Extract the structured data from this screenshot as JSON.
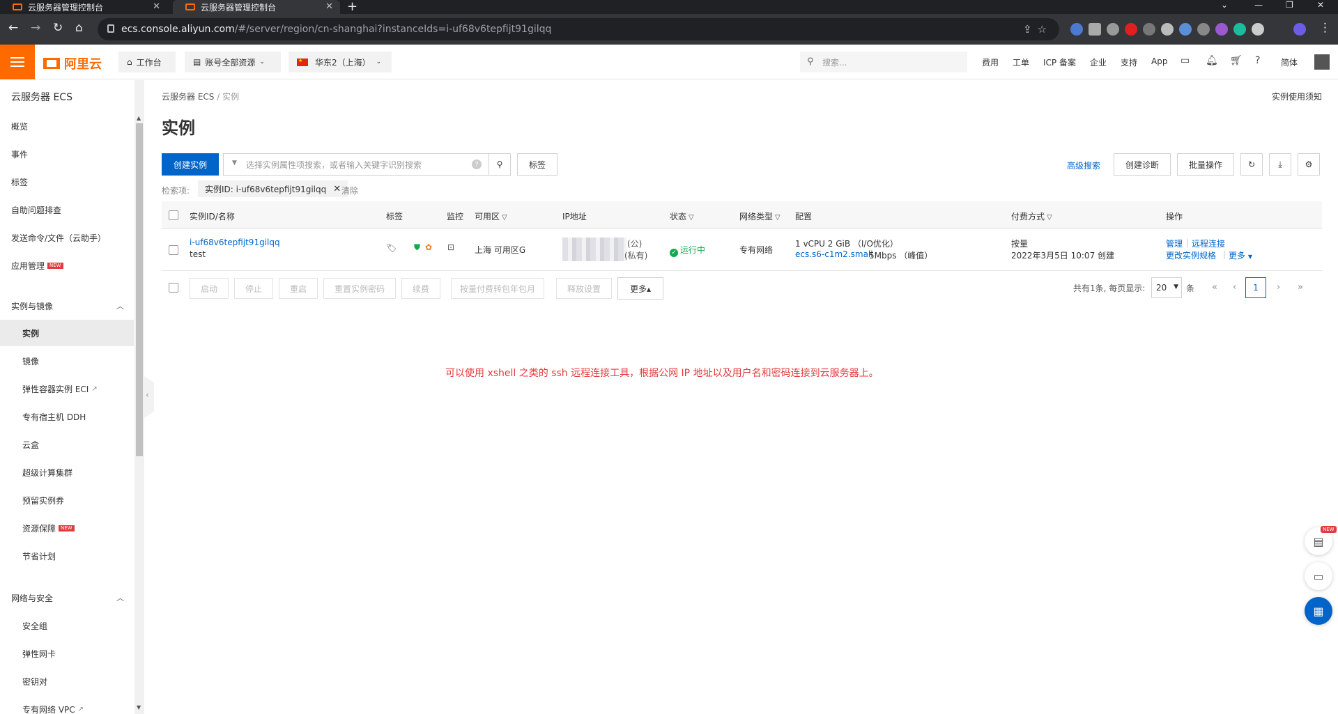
{
  "browser": {
    "tabs": [
      {
        "title": "云服务器管理控制台",
        "active": false
      },
      {
        "title": "云服务器管理控制台",
        "active": true
      }
    ],
    "url_host": "ecs.console.aliyun.com",
    "url_path": "/#/server/region/cn-shanghai?instanceIds=i-uf68v6tepfijt91gilqq"
  },
  "topnav": {
    "logo": "阿里云",
    "workbench": "工作台",
    "resources": "账号全部资源",
    "region": "华东2（上海）",
    "search_placeholder": "搜索...",
    "links": [
      "费用",
      "工单",
      "ICP 备案",
      "企业",
      "支持",
      "App"
    ],
    "lang": "简体"
  },
  "sidebar": {
    "title": "云服务器 ECS",
    "items": [
      "概览",
      "事件",
      "标签",
      "自助问题排查",
      "发送命令/文件（云助手）",
      "应用管理"
    ],
    "new_badge": "NEW",
    "group1": {
      "label": "实例与镜像",
      "items": [
        "实例",
        "镜像",
        "弹性容器实例 ECI",
        "专有宿主机 DDH",
        "云盒",
        "超级计算集群",
        "预留实例券",
        "资源保障",
        "节省计划"
      ]
    },
    "group2": {
      "label": "网络与安全",
      "items": [
        "安全组",
        "弹性网卡",
        "密钥对",
        "专有网络 VPC"
      ]
    }
  },
  "main": {
    "breadcrumb": {
      "root": "云服务器 ECS",
      "sep": "/",
      "current": "实例"
    },
    "notice": "实例使用须知",
    "title": "实例",
    "create_button": "创建实例",
    "search_placeholder": "选择实例属性项搜索，或者输入关键字识别搜索",
    "tag_button": "标签",
    "advanced_search": "高级搜索",
    "diagnose_button": "创建诊断",
    "batch_button": "批量操作",
    "filter_label": "检索项:",
    "filter_chip": "实例ID: i-uf68v6tepfijt91gilqq",
    "filter_clear": "清除",
    "columns": [
      "实例ID/名称",
      "标签",
      "监控",
      "可用区",
      "IP地址",
      "状态",
      "网络类型",
      "配置",
      "付费方式",
      "操作"
    ],
    "row": {
      "id": "i-uf68v6tepfijt91gilqq",
      "name": "test",
      "zone": "上海 可用区G",
      "ip_public_suffix": "(公)",
      "ip_private_suffix": "(私有)",
      "status": "运行中",
      "network": "专有网络",
      "config_line1": "1 vCPU 2 GiB （I/O优化）",
      "config_type": "ecs.s6-c1m2.small",
      "config_bandwidth": "5Mbps （峰值）",
      "billing": "按量",
      "created": "2022年3月5日 10:07 创建",
      "action_manage": "管理",
      "action_remote": "远程连接",
      "action_resize": "更改实例规格",
      "action_more": "更多"
    },
    "bulk_buttons": [
      "启动",
      "停止",
      "重启",
      "重置实例密码",
      "续费",
      "按量付费转包年包月",
      "释放设置"
    ],
    "more_button": "更多▴",
    "pager_text": "共有1条, 每页显示:",
    "page_size": "20",
    "page_size_unit": "条",
    "current_page": "1",
    "annotation": "可以使用 xshell 之类的 ssh 远程连接工具，根据公网 IP 地址以及用户名和密码连接到云服务器上。"
  },
  "float_new": "NEW",
  "colors": {
    "brand": "#ff6a00",
    "primary": "#0064c8",
    "success": "#13a94d",
    "annotation": "#e4393c"
  }
}
